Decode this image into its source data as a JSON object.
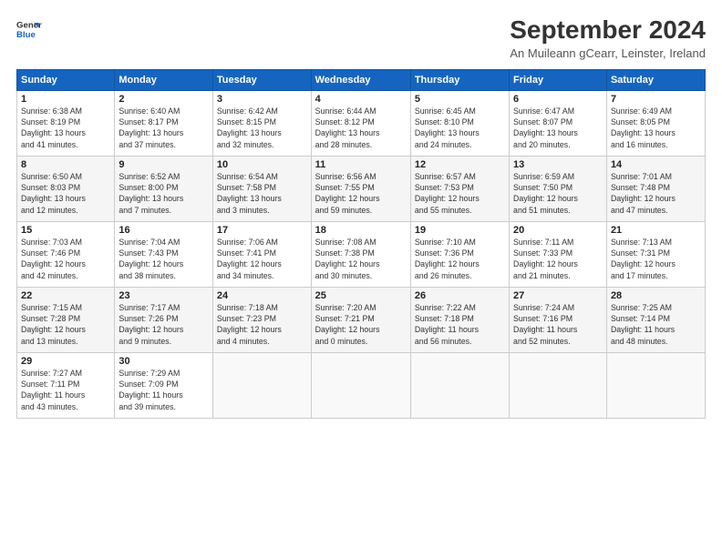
{
  "logo": {
    "line1": "General",
    "line2": "Blue"
  },
  "title": "September 2024",
  "subtitle": "An Muileann gCearr, Leinster, Ireland",
  "weekdays": [
    "Sunday",
    "Monday",
    "Tuesday",
    "Wednesday",
    "Thursday",
    "Friday",
    "Saturday"
  ],
  "weeks": [
    [
      {
        "day": "1",
        "info": "Sunrise: 6:38 AM\nSunset: 8:19 PM\nDaylight: 13 hours\nand 41 minutes."
      },
      {
        "day": "2",
        "info": "Sunrise: 6:40 AM\nSunset: 8:17 PM\nDaylight: 13 hours\nand 37 minutes."
      },
      {
        "day": "3",
        "info": "Sunrise: 6:42 AM\nSunset: 8:15 PM\nDaylight: 13 hours\nand 32 minutes."
      },
      {
        "day": "4",
        "info": "Sunrise: 6:44 AM\nSunset: 8:12 PM\nDaylight: 13 hours\nand 28 minutes."
      },
      {
        "day": "5",
        "info": "Sunrise: 6:45 AM\nSunset: 8:10 PM\nDaylight: 13 hours\nand 24 minutes."
      },
      {
        "day": "6",
        "info": "Sunrise: 6:47 AM\nSunset: 8:07 PM\nDaylight: 13 hours\nand 20 minutes."
      },
      {
        "day": "7",
        "info": "Sunrise: 6:49 AM\nSunset: 8:05 PM\nDaylight: 13 hours\nand 16 minutes."
      }
    ],
    [
      {
        "day": "8",
        "info": "Sunrise: 6:50 AM\nSunset: 8:03 PM\nDaylight: 13 hours\nand 12 minutes."
      },
      {
        "day": "9",
        "info": "Sunrise: 6:52 AM\nSunset: 8:00 PM\nDaylight: 13 hours\nand 7 minutes."
      },
      {
        "day": "10",
        "info": "Sunrise: 6:54 AM\nSunset: 7:58 PM\nDaylight: 13 hours\nand 3 minutes."
      },
      {
        "day": "11",
        "info": "Sunrise: 6:56 AM\nSunset: 7:55 PM\nDaylight: 12 hours\nand 59 minutes."
      },
      {
        "day": "12",
        "info": "Sunrise: 6:57 AM\nSunset: 7:53 PM\nDaylight: 12 hours\nand 55 minutes."
      },
      {
        "day": "13",
        "info": "Sunrise: 6:59 AM\nSunset: 7:50 PM\nDaylight: 12 hours\nand 51 minutes."
      },
      {
        "day": "14",
        "info": "Sunrise: 7:01 AM\nSunset: 7:48 PM\nDaylight: 12 hours\nand 47 minutes."
      }
    ],
    [
      {
        "day": "15",
        "info": "Sunrise: 7:03 AM\nSunset: 7:46 PM\nDaylight: 12 hours\nand 42 minutes."
      },
      {
        "day": "16",
        "info": "Sunrise: 7:04 AM\nSunset: 7:43 PM\nDaylight: 12 hours\nand 38 minutes."
      },
      {
        "day": "17",
        "info": "Sunrise: 7:06 AM\nSunset: 7:41 PM\nDaylight: 12 hours\nand 34 minutes."
      },
      {
        "day": "18",
        "info": "Sunrise: 7:08 AM\nSunset: 7:38 PM\nDaylight: 12 hours\nand 30 minutes."
      },
      {
        "day": "19",
        "info": "Sunrise: 7:10 AM\nSunset: 7:36 PM\nDaylight: 12 hours\nand 26 minutes."
      },
      {
        "day": "20",
        "info": "Sunrise: 7:11 AM\nSunset: 7:33 PM\nDaylight: 12 hours\nand 21 minutes."
      },
      {
        "day": "21",
        "info": "Sunrise: 7:13 AM\nSunset: 7:31 PM\nDaylight: 12 hours\nand 17 minutes."
      }
    ],
    [
      {
        "day": "22",
        "info": "Sunrise: 7:15 AM\nSunset: 7:28 PM\nDaylight: 12 hours\nand 13 minutes."
      },
      {
        "day": "23",
        "info": "Sunrise: 7:17 AM\nSunset: 7:26 PM\nDaylight: 12 hours\nand 9 minutes."
      },
      {
        "day": "24",
        "info": "Sunrise: 7:18 AM\nSunset: 7:23 PM\nDaylight: 12 hours\nand 4 minutes."
      },
      {
        "day": "25",
        "info": "Sunrise: 7:20 AM\nSunset: 7:21 PM\nDaylight: 12 hours\nand 0 minutes."
      },
      {
        "day": "26",
        "info": "Sunrise: 7:22 AM\nSunset: 7:18 PM\nDaylight: 11 hours\nand 56 minutes."
      },
      {
        "day": "27",
        "info": "Sunrise: 7:24 AM\nSunset: 7:16 PM\nDaylight: 11 hours\nand 52 minutes."
      },
      {
        "day": "28",
        "info": "Sunrise: 7:25 AM\nSunset: 7:14 PM\nDaylight: 11 hours\nand 48 minutes."
      }
    ],
    [
      {
        "day": "29",
        "info": "Sunrise: 7:27 AM\nSunset: 7:11 PM\nDaylight: 11 hours\nand 43 minutes."
      },
      {
        "day": "30",
        "info": "Sunrise: 7:29 AM\nSunset: 7:09 PM\nDaylight: 11 hours\nand 39 minutes."
      },
      {
        "day": "",
        "info": ""
      },
      {
        "day": "",
        "info": ""
      },
      {
        "day": "",
        "info": ""
      },
      {
        "day": "",
        "info": ""
      },
      {
        "day": "",
        "info": ""
      }
    ]
  ]
}
